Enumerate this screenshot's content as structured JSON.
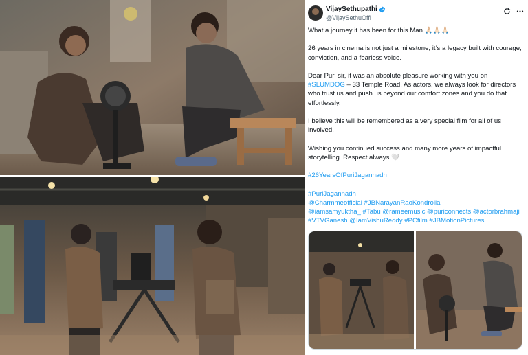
{
  "tweet": {
    "display_name": "VijaySethupathi",
    "handle": "@VijaySethuOffl",
    "icons": [
      "verified-badge-icon",
      "grok-refresh-icon",
      "more-icon"
    ],
    "paragraphs": {
      "p1": "What a journey it has been for this Man 🙏🏻🙏🏻🙏🏻",
      "p2": "26 years in cinema is not just a milestone, it’s a legacy built with courage, conviction, and a fearless voice.",
      "p3_pre": "Dear Puri sir, it was an absolute pleasure working with you on ",
      "p3_link": "#SLUMDOG",
      "p3_post": " – 33 Temple Road. As actors, we always look for directors who trust us and push us beyond our comfort zones and you do that effortlessly.",
      "p4": "I believe this will be remembered as a very special film for all of us involved.",
      "p5": "Wishing you continued success and many more years of impactful storytelling. Respect always 🤍"
    },
    "hashtag_main": "#26YearsOfPuriJagannadh",
    "tag_lines": {
      "line1": "#PuriJagannadh",
      "line2": "@Charmmeofficial #JBNarayanRaoKondrolla",
      "line3": "@iamsamyuktha_ #Tabu @rameemusic @puriconnects @actorbrahmaji",
      "line4": "#VTVGanesh @IamVishuReddy #PCfilm #JBMotionPictures"
    }
  },
  "colors": {
    "link": "#1d9bf0",
    "text": "#0f1419",
    "muted": "#536471",
    "verified": "#1d9bf0"
  }
}
